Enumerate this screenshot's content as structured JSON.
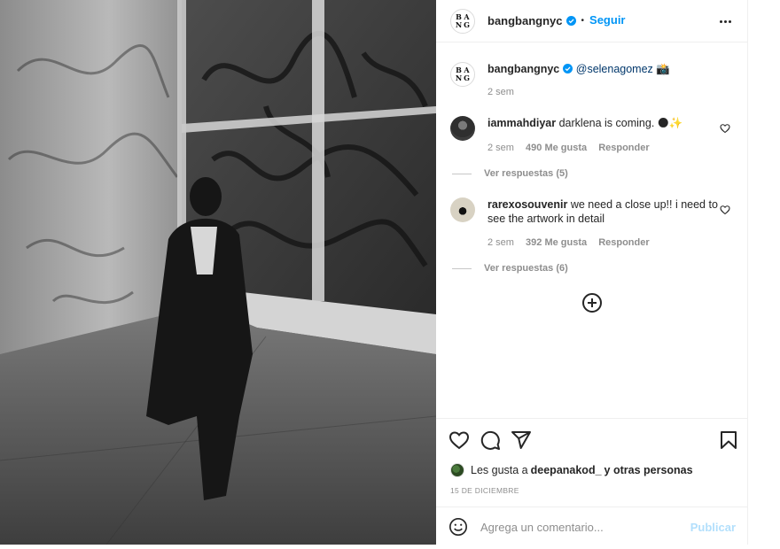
{
  "post": {
    "author": "bangbangnyc",
    "follow_label": "Seguir",
    "logo_letters": [
      "B",
      "A",
      "N",
      "G"
    ]
  },
  "caption": {
    "username": "bangbangnyc",
    "mention": "@selenagomez",
    "emoji": "📸",
    "time": "2 sem"
  },
  "comments": [
    {
      "username": "iammahdiyar",
      "text": "darklena is coming. 🌑✨",
      "time": "2 sem",
      "likes": "490 Me gusta",
      "reply_label": "Responder",
      "view_replies": "Ver respuestas (5)"
    },
    {
      "username": "rarexosouvenir",
      "text": "we need a close up!! i need to see the artwork in detail",
      "time": "2 sem",
      "likes": "392 Me gusta",
      "reply_label": "Responder",
      "view_replies": "Ver respuestas (6)"
    }
  ],
  "likes_line": {
    "prefix": "Les gusta a",
    "user": "deepanakod_",
    "suffix": "y otras personas"
  },
  "date": "15 DE DICIEMBRE",
  "composer": {
    "placeholder": "Agrega un comentario...",
    "publish_label": "Publicar"
  },
  "colors": {
    "accent": "#0095f6",
    "publish_disabled": "#b2dffc",
    "muted": "#8e8e8e"
  },
  "icons": [
    "verified-badge-icon",
    "more-options-icon",
    "heart-icon",
    "comment-icon",
    "share-icon",
    "bookmark-icon",
    "plus-circle-icon",
    "emoji-icon"
  ]
}
